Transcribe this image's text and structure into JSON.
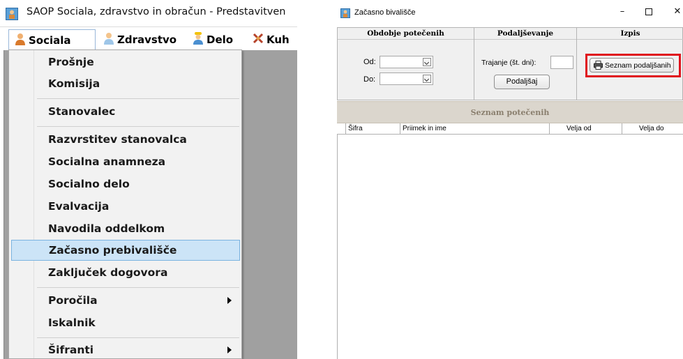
{
  "left": {
    "title": "SAOP Sociala, zdravstvo in obračun - Predstavitven",
    "menubar": [
      "Sociala",
      "Zdravstvo",
      "Delo",
      "Kuh"
    ],
    "menu_items": [
      {
        "label": "Prošnje"
      },
      {
        "label": "Komisija"
      },
      {
        "label": "Stanovalec"
      },
      {
        "label": "Razvrstitev stanovalca"
      },
      {
        "label": "Socialna anamneza"
      },
      {
        "label": "Socialno delo"
      },
      {
        "label": "Evalvacija"
      },
      {
        "label": "Navodila oddelkom"
      },
      {
        "label": "Začasno prebivališče",
        "highlighted": true
      },
      {
        "label": "Zaključek dogovora"
      },
      {
        "label": "Poročila",
        "submenu": true
      },
      {
        "label": "Iskalnik"
      },
      {
        "label": "Šifranti",
        "submenu": true
      }
    ]
  },
  "window": {
    "title": "Začasno bivališče",
    "controls": {
      "minimize": "–",
      "close": "✕"
    },
    "sections": {
      "period": "Obdobje potečenih",
      "extension": "Podaljševanje",
      "print": "Izpis"
    },
    "form": {
      "from_label": "Od:",
      "to_label": "Do:",
      "duration_label": "Trajanje (št. dni):",
      "extend_button": "Podaljšaj",
      "list_button": "Seznam podaljšanih"
    },
    "list_title": "Seznam potečenih",
    "columns": [
      "Šifra",
      "Priimek in ime",
      "Velja od",
      "Velja do"
    ],
    "rows": []
  },
  "colors": {
    "highlight_box": "#e0141e",
    "menu_selection": "#cce4f7",
    "section_header_bg": "#dbd6cd"
  }
}
